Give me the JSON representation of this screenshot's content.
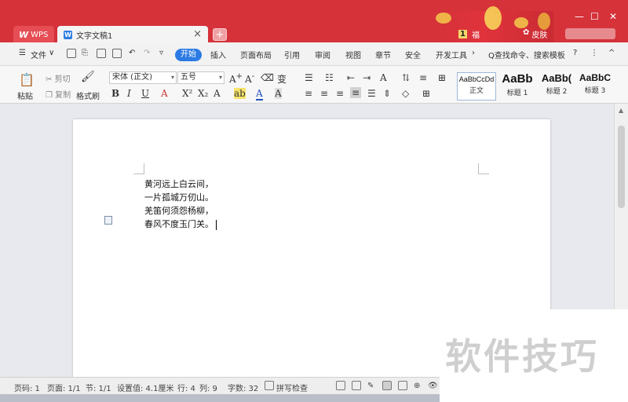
{
  "tabs": {
    "wps_label": "WPS",
    "doc_label": "文字文稿1",
    "close": "×",
    "add": "+"
  },
  "title_bar": {
    "user_number": "1",
    "user_text": "福",
    "skin_label": "皮肤",
    "gift_label": "福",
    "minimize": "—",
    "maximize": "☐",
    "close": "✕"
  },
  "menu": {
    "file": "文件",
    "items": [
      "开始",
      "插入",
      "页面布局",
      "引用",
      "审阅",
      "视图",
      "章节",
      "安全",
      "开发工具"
    ],
    "search": "Q查找命令、搜索模板",
    "help": "?",
    "more": "⋮",
    "collapse": "^"
  },
  "ribbon": {
    "paste": "粘贴",
    "cut": "剪切",
    "copy": "复制",
    "format_painter": "格式刷",
    "font_name": "宋体 (正文)",
    "font_size": "五号",
    "bold": "B",
    "italic": "I",
    "underline": "U",
    "styles": [
      {
        "preview": "AaBbCcDd",
        "label": "正文"
      },
      {
        "preview": "AaBb",
        "label": "标题 1"
      },
      {
        "preview": "AaBb(",
        "label": "标题 2"
      },
      {
        "preview": "AaBbC",
        "label": "标题 3"
      }
    ]
  },
  "document": {
    "lines": [
      "黄河远上白云间，",
      "一片孤城万仞山。",
      "羌笛何须怨杨柳，",
      "春风不度玉门关。"
    ]
  },
  "status": {
    "page_no": "页码: 1",
    "pages": "页面: 1/1",
    "section": "节: 1/1",
    "setting": "设置值: 4.1厘米",
    "row": "行: 4",
    "col": "列: 9",
    "word_count": "字数: 32",
    "spell_check": "拼写检查"
  },
  "watermark": "软件技巧"
}
